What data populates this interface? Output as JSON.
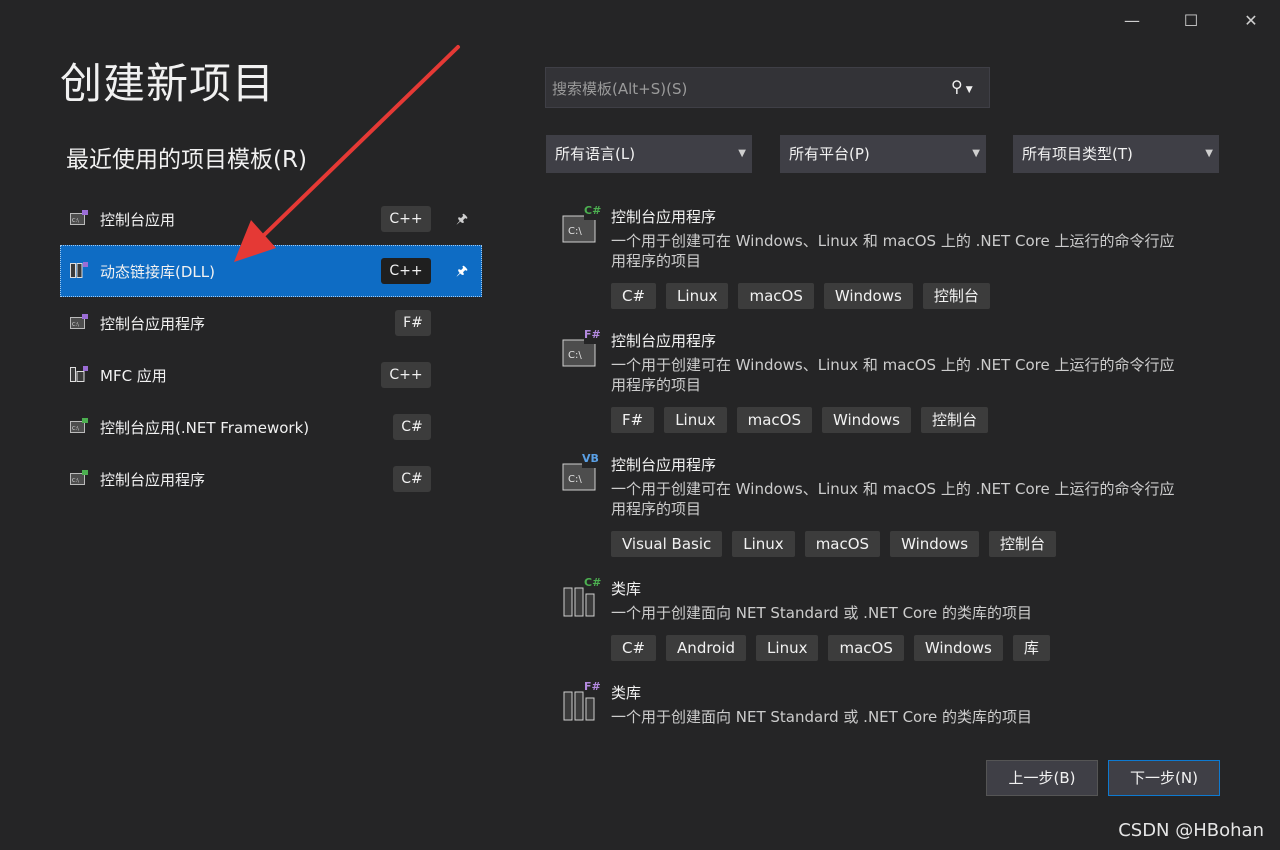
{
  "window": {
    "minimize_label": "—",
    "maximize_label": "☐",
    "close_label": "✕"
  },
  "title": "创建新项目",
  "recent": {
    "title": "最近使用的项目模板(R)",
    "items": [
      {
        "label": "控制台应用",
        "tag": "C++",
        "pinned": true
      },
      {
        "label": "动态链接库(DLL)",
        "tag": "C++",
        "pinned": true,
        "selected": true
      },
      {
        "label": "控制台应用程序",
        "tag": "F#",
        "pinned": false
      },
      {
        "label": "MFC 应用",
        "tag": "C++",
        "pinned": false
      },
      {
        "label": "控制台应用(.NET Framework)",
        "tag": "C#",
        "pinned": false
      },
      {
        "label": "控制台应用程序",
        "tag": "C#",
        "pinned": false
      }
    ]
  },
  "search": {
    "placeholder": "搜索模板(Alt+S)(S)"
  },
  "filters": {
    "language": "所有语言(L)",
    "platform": "所有平台(P)",
    "project_type": "所有项目类型(T)"
  },
  "templates": [
    {
      "name": "控制台应用程序",
      "lang_badge": "C#",
      "desc": "一个用于创建可在 Windows、Linux 和 macOS 上的 .NET Core 上运行的命令行应用程序的项目",
      "tags": [
        "C#",
        "Linux",
        "macOS",
        "Windows",
        "控制台"
      ]
    },
    {
      "name": "控制台应用程序",
      "lang_badge": "F#",
      "desc": "一个用于创建可在 Windows、Linux 和 macOS 上的 .NET Core 上运行的命令行应用程序的项目",
      "tags": [
        "F#",
        "Linux",
        "macOS",
        "Windows",
        "控制台"
      ]
    },
    {
      "name": "控制台应用程序",
      "lang_badge": "VB",
      "desc": "一个用于创建可在 Windows、Linux 和 macOS 上的 .NET Core 上运行的命令行应用程序的项目",
      "tags": [
        "Visual Basic",
        "Linux",
        "macOS",
        "Windows",
        "控制台"
      ]
    },
    {
      "name": "类库",
      "lang_badge": "C#",
      "desc": "一个用于创建面向 NET Standard 或 .NET Core 的类库的项目",
      "tags": [
        "C#",
        "Android",
        "Linux",
        "macOS",
        "Windows",
        "库"
      ]
    },
    {
      "name": "类库",
      "lang_badge": "F#",
      "desc": "一个用于创建面向 NET Standard 或 .NET Core 的类库的项目",
      "tags": []
    }
  ],
  "buttons": {
    "back": "上一步(B)",
    "next": "下一步(N)"
  },
  "watermark": "CSDN @HBohan",
  "colors": {
    "background": "#252526",
    "selected": "#0e6cc4",
    "arrow": "#e53935",
    "accent": "#68217a"
  }
}
